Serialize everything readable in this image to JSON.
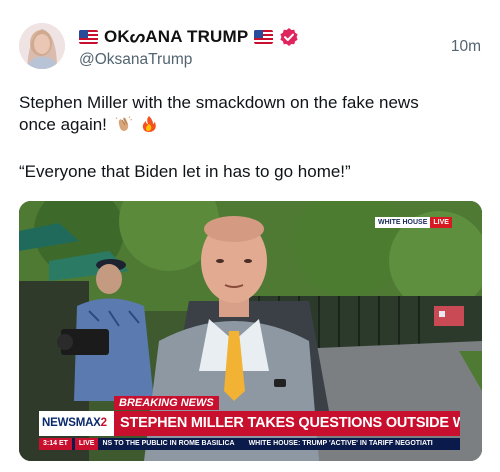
{
  "tweet": {
    "display_name": "OKᔕANA TRUMP",
    "handle": "@OksanaTrump",
    "timestamp": "10m",
    "flag_icon": "us-flag-icon",
    "verified_icon": "verified-badge-icon",
    "verified_color": "#e0245e",
    "text_line1": "Stephen Miller with the smackdown on the fake news",
    "text_line2": "once again!",
    "text_line2_emojis": [
      "clapping-hands-icon",
      "fire-icon"
    ],
    "text_quote": "“Everyone that Biden let in has to go home!”"
  },
  "media": {
    "corner_bug": "WHITE HOUSE",
    "corner_live": "LIVE",
    "breaking_label": "BREAKING NEWS",
    "network_logo_a": "NEWSMAX",
    "network_logo_b": "2",
    "headline": "STEPHEN MILLER TAKES QUESTIONS OUTSIDE WH",
    "ticker_time": "3:14 ET",
    "ticker_live": "LIVE",
    "ticker_text_1": "NS TO THE PUBLIC IN ROME BASILICA",
    "ticker_text_2": "WHITE HOUSE: TRUMP 'ACTIVE' IN TARIFF NEGOTIATI",
    "accent_red": "#c8102e",
    "accent_navy": "#0a1a4a"
  }
}
